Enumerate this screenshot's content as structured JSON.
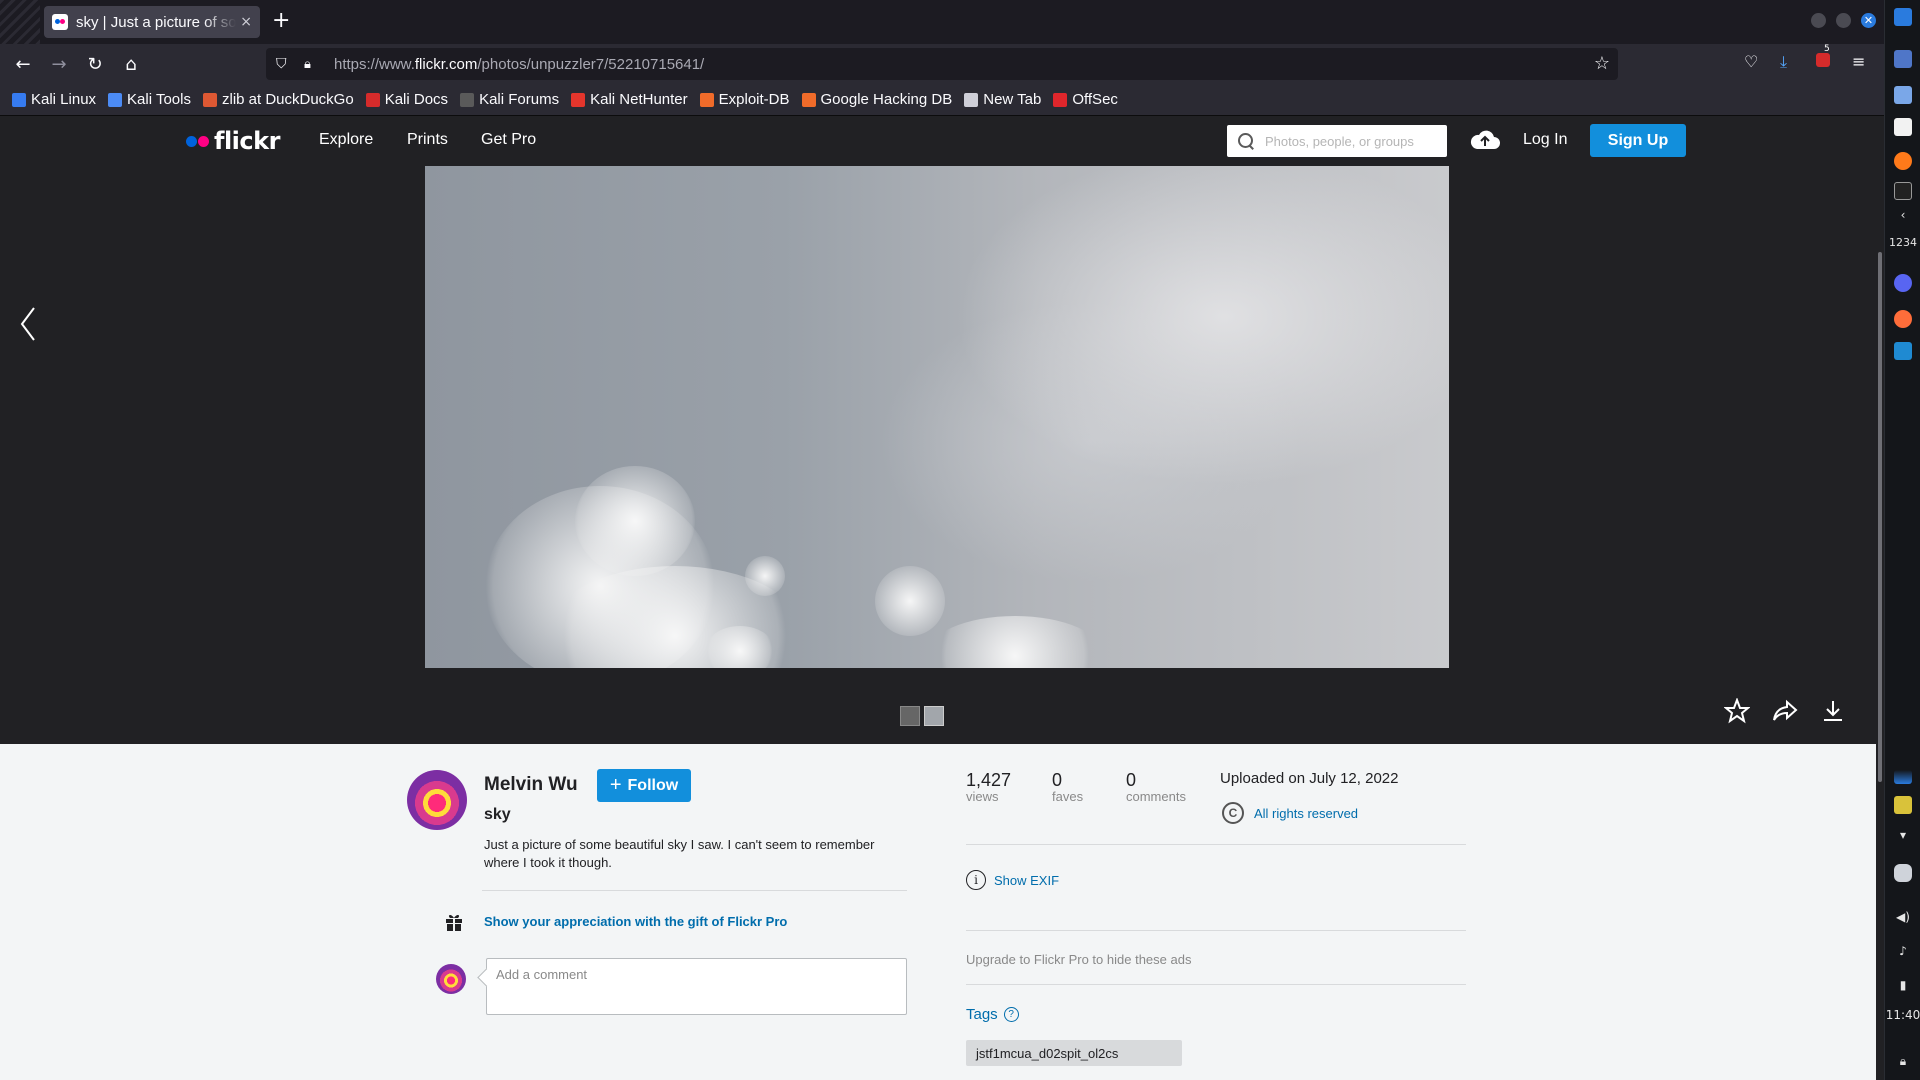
{
  "browser": {
    "tab_title": "sky | Just a picture of som",
    "tab_close": "×",
    "new_tab": "+",
    "url_prefix": "https://www.",
    "url_host": "flickr.com",
    "url_path": "/photos/unpuzzler7/52210715641/",
    "downloads_badge": "5"
  },
  "bookmarks": [
    {
      "label": "Kali Linux",
      "color": "#367bf0"
    },
    {
      "label": "Kali Tools",
      "color": "#4c8bf5"
    },
    {
      "label": "zlib at DuckDuckGo",
      "color": "#de5833"
    },
    {
      "label": "Kali Docs",
      "color": "#d62b2b"
    },
    {
      "label": "Kali Forums",
      "color": "#5a5a5a"
    },
    {
      "label": "Kali NetHunter",
      "color": "#e4352c"
    },
    {
      "label": "Exploit-DB",
      "color": "#f06b2a"
    },
    {
      "label": "Google Hacking DB",
      "color": "#f06b2a"
    },
    {
      "label": "New Tab",
      "color": "#cfcfd8"
    },
    {
      "label": "OffSec",
      "color": "#e0262c"
    }
  ],
  "flickr": {
    "logo": "flickr",
    "nav": [
      "Explore",
      "Prints",
      "Get Pro"
    ],
    "search_placeholder": "Photos, people, or groups",
    "login": "Log In",
    "signup": "Sign Up",
    "brand_blue": "#0063dc",
    "brand_pink": "#ff0084",
    "accent": "#128fdc"
  },
  "owner": {
    "name": "Melvin Wu",
    "follow": "Follow"
  },
  "photo": {
    "title": "sky",
    "description": "Just a picture of some beautiful sky I saw. I can't seem to remember where I took it though."
  },
  "gift_link": "Show your appreciation with the gift of Flickr Pro",
  "comment_placeholder": "Add a comment",
  "stats": [
    {
      "value": "1,427",
      "label": "views"
    },
    {
      "value": "0",
      "label": "faves"
    },
    {
      "value": "0",
      "label": "comments"
    }
  ],
  "uploaded": "Uploaded on July 12, 2022",
  "license_symbol": "C",
  "license": "All rights reserved",
  "show_exif": "Show EXIF",
  "upgrade": "Upgrade to Flickr Pro to hide these ads",
  "tags_label": "Tags",
  "tag_first": "jstf1mcua_d02spit_ol2cs",
  "os_panel": {
    "workspace": "1234",
    "clock": "11:40"
  }
}
